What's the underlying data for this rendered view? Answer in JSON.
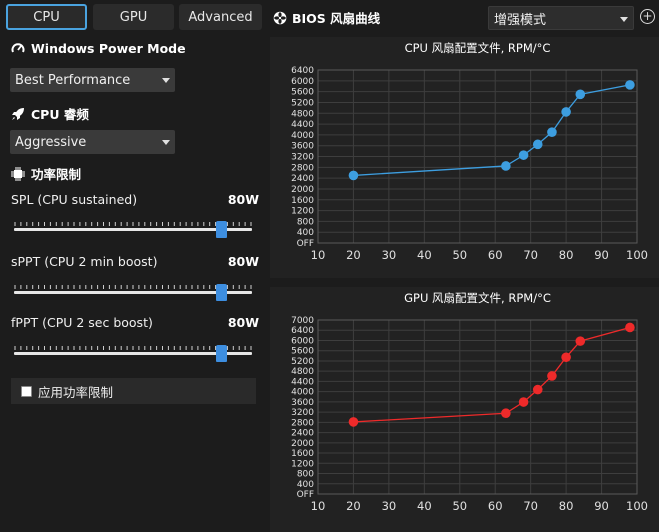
{
  "tabs": [
    {
      "label": "CPU",
      "active": true
    },
    {
      "label": "GPU",
      "active": false
    },
    {
      "label": "Advanced",
      "active": false
    }
  ],
  "power_mode": {
    "title": "Windows Power Mode",
    "icon": "gauge-icon",
    "selected": "Best Performance"
  },
  "cpu_boost": {
    "title": "CPU 睿频",
    "icon": "rocket-icon",
    "selected": "Aggressive"
  },
  "power_limits": {
    "title": "功率限制",
    "icon": "chip-icon",
    "sliders": [
      {
        "label": "SPL (CPU sustained)",
        "value": "80W",
        "fraction": 0.87
      },
      {
        "label": "sPPT (CPU 2 min boost)",
        "value": "80W",
        "fraction": 0.87
      },
      {
        "label": "fPPT (CPU 2 sec boost)",
        "value": "80W",
        "fraction": 0.87
      }
    ],
    "apply_label": "应用功率限制",
    "apply_checked": false
  },
  "bios": {
    "title": "BIOS 风扇曲线",
    "icon": "fan-icon",
    "mode_selected": "增强模式",
    "add_icon": "plus-circle-icon"
  },
  "colors": {
    "accent": "#4aa3df",
    "cpu_curve": "#3d9ee0",
    "gpu_curve": "#ee2a2a",
    "background": "#1c1c1c",
    "panel": "#222222"
  },
  "chart_data": [
    {
      "type": "line",
      "title": "CPU 风扇配置文件, RPM/°C",
      "x": [
        20,
        63,
        68,
        72,
        76,
        80,
        84,
        98
      ],
      "series": [
        {
          "values": [
            2500,
            2850,
            3250,
            3650,
            4100,
            4850,
            5500,
            5850
          ]
        }
      ],
      "xlim": [
        10,
        100
      ],
      "ylim": [
        0,
        6400
      ],
      "xticks": [
        "10",
        "20",
        "30",
        "40",
        "50",
        "60",
        "70",
        "80",
        "90",
        "100"
      ],
      "yticks": [
        "OFF",
        "400",
        "800",
        "1200",
        "1600",
        "2000",
        "2400",
        "2800",
        "3200",
        "3600",
        "4000",
        "4400",
        "4800",
        "5200",
        "5600",
        "6000",
        "6400"
      ],
      "grid": true
    },
    {
      "type": "line",
      "title": "GPU 风扇配置文件, RPM/°C",
      "x": [
        20,
        63,
        68,
        72,
        76,
        80,
        84,
        98
      ],
      "series": [
        {
          "values": [
            2900,
            3250,
            3700,
            4200,
            4750,
            5500,
            6150,
            6700
          ]
        }
      ],
      "xlim": [
        10,
        100
      ],
      "ylim": [
        0,
        7000
      ],
      "xticks": [
        "10",
        "20",
        "30",
        "40",
        "50",
        "60",
        "70",
        "80",
        "90",
        "100"
      ],
      "yticks": [
        "OFF",
        "400",
        "800",
        "1200",
        "1600",
        "2000",
        "2400",
        "2800",
        "3200",
        "3600",
        "4000",
        "4400",
        "4800",
        "5200",
        "5600",
        "6000",
        "6400",
        "7000"
      ],
      "grid": true
    }
  ]
}
